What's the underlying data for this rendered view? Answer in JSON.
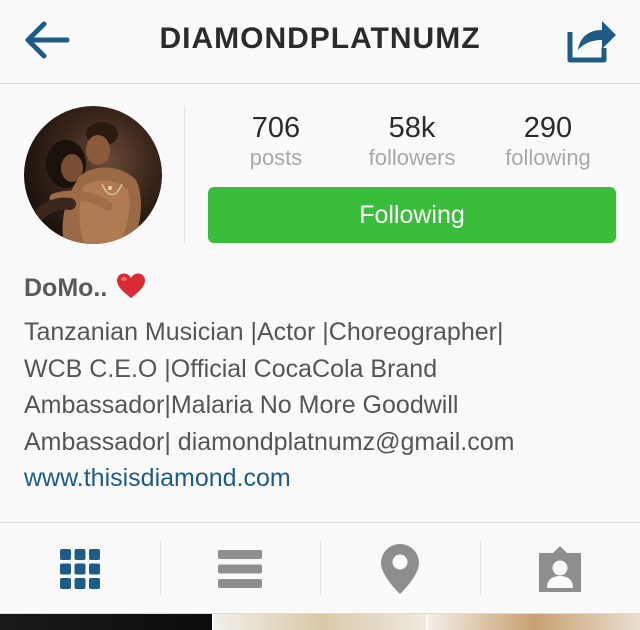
{
  "header": {
    "title": "DIAMONDPLATNUMZ",
    "back_icon": "arrow-left-icon",
    "share_icon": "share-icon"
  },
  "stats": {
    "posts": {
      "count": "706",
      "label": "posts"
    },
    "followers": {
      "count": "58k",
      "label": "followers"
    },
    "following": {
      "count": "290",
      "label": "following"
    }
  },
  "follow_button": {
    "label": "Following"
  },
  "profile": {
    "name": "DoMo..",
    "bio_lines": [
      "Tanzanian Musician |Actor |Choreographer|",
      "WCB C.E.O |Official CocaCola Brand",
      "Ambassador|Malaria No More Goodwill",
      "Ambassador| diamondplatnumz@gmail.com"
    ],
    "website": "www.thisisdiamond.com"
  },
  "tabs": [
    {
      "icon": "grid-icon",
      "active": true
    },
    {
      "icon": "list-icon",
      "active": false
    },
    {
      "icon": "location-pin-icon",
      "active": false
    },
    {
      "icon": "tagged-photos-icon",
      "active": false
    }
  ],
  "colors": {
    "accent": "#1f5b87",
    "follow_green": "#3bbd3c",
    "inactive_icon": "#8e8e8e"
  }
}
